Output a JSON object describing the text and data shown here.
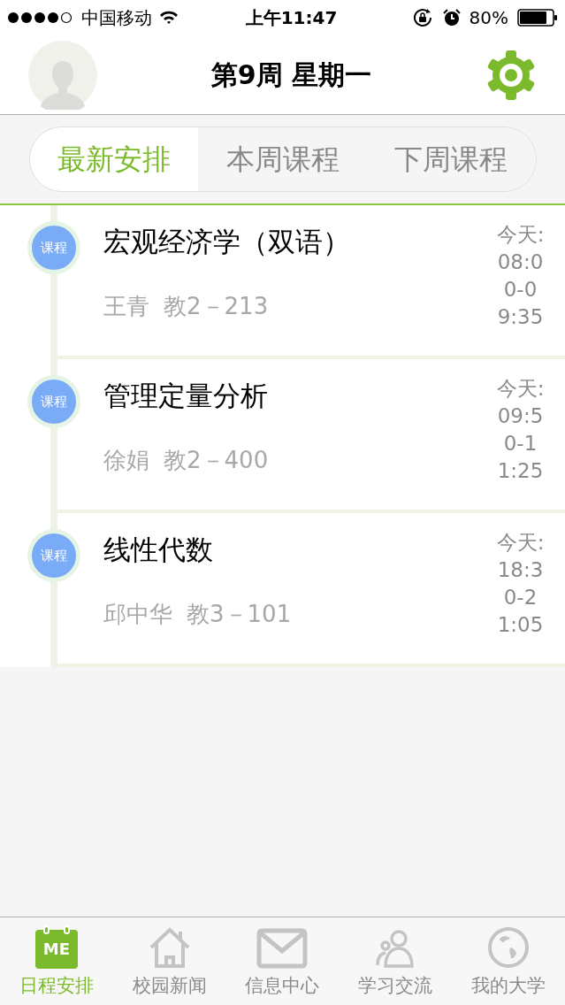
{
  "status_bar": {
    "carrier": "中国移动",
    "time": "上午11:47",
    "battery": "80%"
  },
  "header": {
    "title": "第9周 星期一"
  },
  "tabs": [
    {
      "label": "最新安排",
      "selected": true
    },
    {
      "label": "本周课程",
      "selected": false
    },
    {
      "label": "下周课程",
      "selected": false
    }
  ],
  "schedule": [
    {
      "badge": "课程",
      "course": "宏观经济学（双语）",
      "teacher": "王青",
      "room": "教2－213",
      "time": "今天:08:00-09:35"
    },
    {
      "badge": "课程",
      "course": "管理定量分析",
      "teacher": "徐娟",
      "room": "教2－400",
      "time": "今天:09:50-11:25"
    },
    {
      "badge": "课程",
      "course": "线性代数",
      "teacher": "邱中华",
      "room": "教3－101",
      "time": "今天:18:30-21:05"
    }
  ],
  "tab_bar": [
    {
      "label": "日程安排",
      "kind": "calendar",
      "icon_text": "ME",
      "selected": true
    },
    {
      "label": "校园新闻",
      "kind": "house",
      "selected": false
    },
    {
      "label": "信息中心",
      "kind": "mail",
      "selected": false
    },
    {
      "label": "学习交流",
      "kind": "people",
      "selected": false
    },
    {
      "label": "我的大学",
      "kind": "globe",
      "selected": false
    }
  ]
}
